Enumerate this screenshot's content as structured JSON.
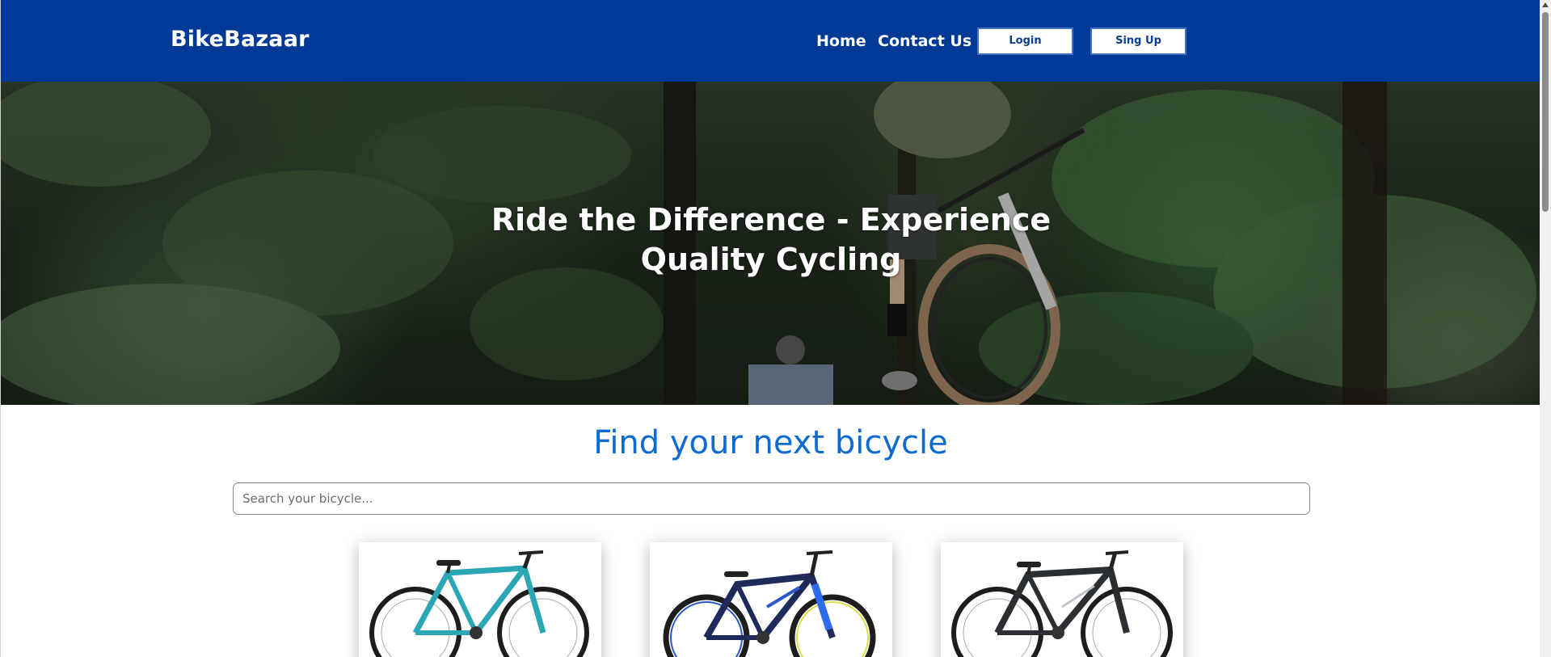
{
  "navbar": {
    "brand": "BikeBazaar",
    "links": [
      "Home",
      "Contact Us"
    ],
    "login_label": "Login",
    "signup_label": "Sing Up"
  },
  "hero": {
    "title": "Ride the Difference - Experience Quality Cycling"
  },
  "main": {
    "title": "Find your next bicycle",
    "search_placeholder": "Search your bicycle..."
  },
  "products": [
    {
      "image": "teal-mountain-bike-icon",
      "frame_color": "#2aa6b4"
    },
    {
      "image": "black-blue-kids-bike-icon",
      "frame_color": "#1d2a5a"
    },
    {
      "image": "black-grey-mountain-bike-icon",
      "frame_color": "#2b2e33"
    }
  ],
  "colors": {
    "navbar": "#013a96",
    "accent": "#0d6ad1"
  }
}
